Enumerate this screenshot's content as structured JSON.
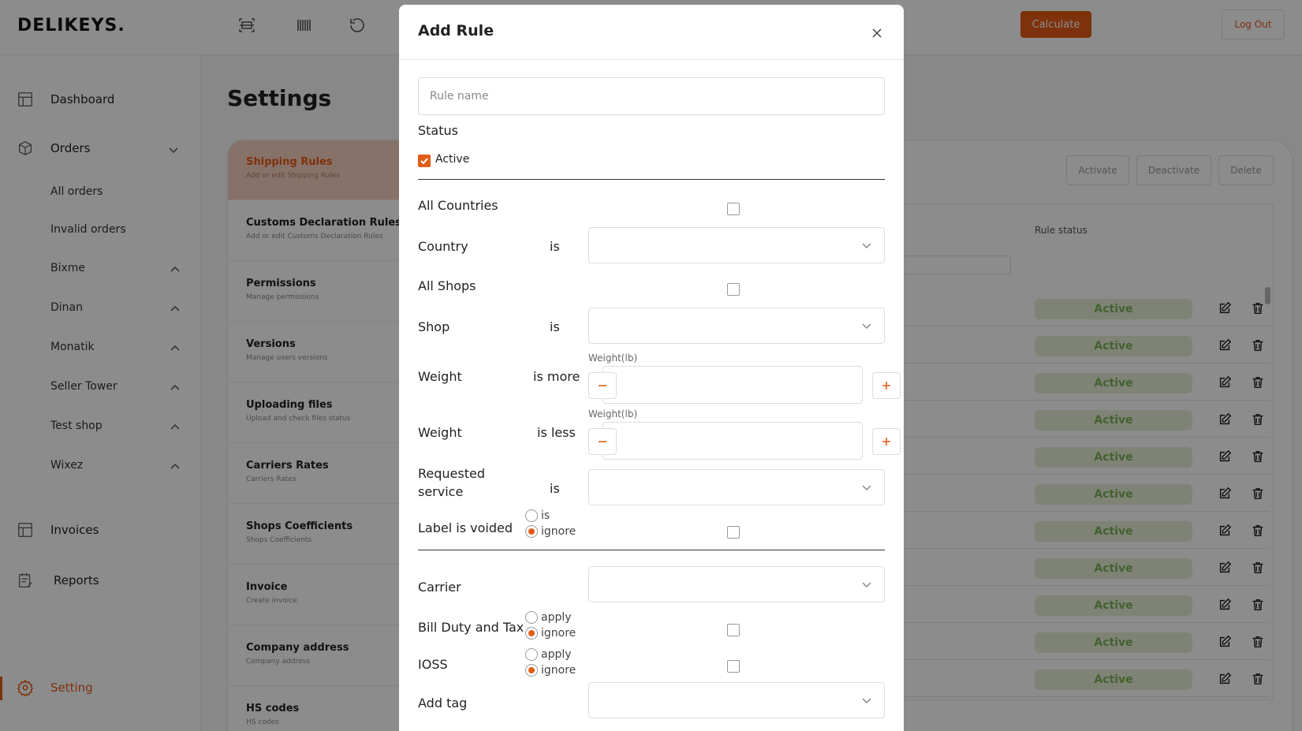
{
  "header": {
    "logo": "DELIKEYS.",
    "calculate_label": "Calculate",
    "logout_label": "Log Out",
    "icons": [
      "scan-icon",
      "barcode-icon",
      "refresh-icon"
    ]
  },
  "sidebar": {
    "dashboard": "Dashboard",
    "orders": "Orders",
    "all_orders": "All orders",
    "invalid_orders": "Invalid orders",
    "shops": [
      "Bixme",
      "Dinan",
      "Monatik",
      "Seller Tower",
      "Test shop",
      "Wixez"
    ],
    "invoices": "Invoices",
    "reports": "Reports",
    "setting": "Setting"
  },
  "page": {
    "title": "Settings",
    "menu": [
      {
        "title": "Shipping Rules",
        "sub": "Add or edit Shipping Rules"
      },
      {
        "title": "Customs Declaration Rules",
        "sub": "Add or edit Customs Declaration Rules"
      },
      {
        "title": "Permissions",
        "sub": "Manage permissions"
      },
      {
        "title": "Versions",
        "sub": "Manage users versions"
      },
      {
        "title": "Uploading files",
        "sub": "Upload and check files status"
      },
      {
        "title": "Carriers Rates",
        "sub": "Carriers Rates"
      },
      {
        "title": "Shops Coefficients",
        "sub": "Shops Coefficients"
      },
      {
        "title": "Invoice",
        "sub": "Create invoice"
      },
      {
        "title": "Company address",
        "sub": "Company address"
      },
      {
        "title": "HS codes",
        "sub": "HS codes"
      }
    ],
    "actions": {
      "activate": "Activate",
      "deactivate": "Deactivate",
      "delete": "Delete"
    },
    "column_header": "Rule status",
    "rows": [
      "Active",
      "Active",
      "Active",
      "Active",
      "Active",
      "Active",
      "Active",
      "Active",
      "Active",
      "Active",
      "Active"
    ]
  },
  "modal": {
    "title": "Add Rule",
    "rule_name_placeholder": "Rule name",
    "status_label": "Status",
    "active_label": "Active",
    "all_countries": "All Countries",
    "country": "Country",
    "is": "is",
    "all_shops": "All Shops",
    "shop": "Shop",
    "weight": "Weight",
    "is_more": "is more",
    "is_less": "is less",
    "weight_unit": "Weight(lb)",
    "requested_service_1": "Requested",
    "requested_service_2": "service",
    "label_voided": "Label is voided",
    "opt_is": "is",
    "opt_ignore": "ignore",
    "carrier": "Carrier",
    "bill_duty": "Bill Duty and Tax",
    "opt_apply": "apply",
    "ioss": "IOSS",
    "add_tag": "Add tag"
  },
  "colors": {
    "accent": "#e35c16",
    "active_badge_bg": "#e6efd8",
    "active_badge_text": "#7ab25a"
  }
}
